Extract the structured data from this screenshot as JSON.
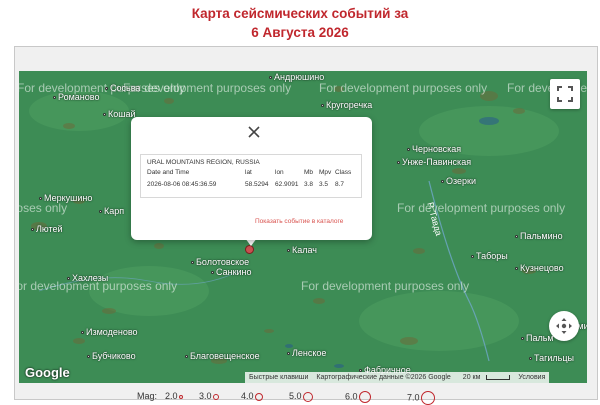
{
  "page": {
    "title_line1": "Карта сейсмических событий за",
    "title_line2": "6 Августа 2026"
  },
  "watermark": "For development purposes only",
  "towns": [
    {
      "name": "Андрюшино"
    },
    {
      "name": "Романово"
    },
    {
      "name": "Сосьва"
    },
    {
      "name": "Кошай"
    },
    {
      "name": "Кругоречка"
    },
    {
      "name": "Черновская"
    },
    {
      "name": "Унже-Павинская"
    },
    {
      "name": "Озерки"
    },
    {
      "name": "Меркушино"
    },
    {
      "name": "Карп"
    },
    {
      "name": "Лютей"
    },
    {
      "name": "Калач"
    },
    {
      "name": "Болотовское"
    },
    {
      "name": "Санкино"
    },
    {
      "name": "Пальмино"
    },
    {
      "name": "Таборы"
    },
    {
      "name": "Кузнецово"
    },
    {
      "name": "Хахлезы"
    },
    {
      "name": "Измоденово"
    },
    {
      "name": "Бубчиково"
    },
    {
      "name": "Благовещенское"
    },
    {
      "name": "Ленское"
    },
    {
      "name": "Фабричное"
    },
    {
      "name": "Пальм"
    },
    {
      "name": "Пальмино"
    },
    {
      "name": "Тагильцы"
    }
  ],
  "river": "Р. Тавда",
  "controls": {
    "fullscreen_icon": "fullscreen-icon",
    "pegman_icon": "move-icon",
    "close_icon": "close-icon"
  },
  "google_logo": "Google",
  "attribution": {
    "shortcuts": "Быстрые клавиши",
    "map_data": "Картографические данные ©2026 Google",
    "scale": "20 км",
    "terms": "Условия"
  },
  "popup": {
    "region": "URAL MOUNTAINS REGION, RUSSIA",
    "headers": {
      "datetime": "Date and Time",
      "lat": "lat",
      "lon": "lon",
      "mb": "Mb",
      "mpv": "Mpv",
      "class": "Class"
    },
    "values": {
      "datetime": "2026-08-06 08:45:36.59",
      "lat": "58.5294",
      "lon": "62.9091",
      "mb": "3.8",
      "mpv": "3.5",
      "class": "8.7"
    },
    "catalog_link": "Показать событие в каталоге"
  },
  "magnitude_legend": {
    "label": "Mag:",
    "items": [
      "2.0",
      "3.0",
      "4.0",
      "5.0",
      "6.0",
      "7.0"
    ]
  },
  "colors": {
    "title": "#c0272d",
    "map_green": "#3b8a52",
    "marker": "#c85050",
    "link": "#d9534f"
  }
}
